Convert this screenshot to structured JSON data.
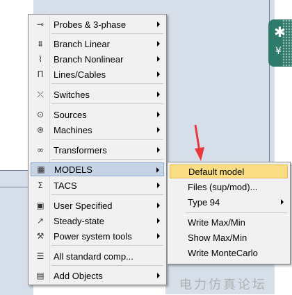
{
  "main_menu": {
    "items": [
      {
        "label": "Probes & 3-phase",
        "icon": "probe-icon",
        "glyph": "⊸"
      },
      {
        "label": "Branch Linear",
        "icon": "branch-linear-icon",
        "glyph": "⩩"
      },
      {
        "label": "Branch Nonlinear",
        "icon": "branch-nonlinear-icon",
        "glyph": "⌇"
      },
      {
        "label": "Lines/Cables",
        "icon": "lines-cables-icon",
        "glyph": "Π"
      },
      {
        "label": "Switches",
        "icon": "switch-icon",
        "glyph": "⤫"
      },
      {
        "label": "Sources",
        "icon": "source-icon",
        "glyph": "⊙"
      },
      {
        "label": "Machines",
        "icon": "machine-icon",
        "glyph": "⊛"
      },
      {
        "label": "Transformers",
        "icon": "transformer-icon",
        "glyph": "∞"
      },
      {
        "label": "MODELS",
        "icon": "models-icon",
        "glyph": "▦"
      },
      {
        "label": "TACS",
        "icon": "tacs-icon",
        "glyph": "Σ"
      },
      {
        "label": "User Specified",
        "icon": "user-specified-icon",
        "glyph": "▣"
      },
      {
        "label": "Steady-state",
        "icon": "steady-state-icon",
        "glyph": "↗"
      },
      {
        "label": "Power system tools",
        "icon": "power-tools-icon",
        "glyph": "⚒"
      },
      {
        "label": "All standard comp...",
        "icon": "all-components-icon",
        "glyph": "☰"
      },
      {
        "label": "Add Objects",
        "icon": "add-objects-icon",
        "glyph": "▤"
      }
    ]
  },
  "sub_menu": {
    "items": [
      {
        "label": "Default model"
      },
      {
        "label": "Files (sup/mod)..."
      },
      {
        "label": "Type 94"
      },
      {
        "label": "Write Max/Min"
      },
      {
        "label": "Show Max/Min"
      },
      {
        "label": "Write MonteCarlo"
      }
    ]
  },
  "watermark": "电力仿真论坛",
  "app_icon": {
    "glyph_top": "✱",
    "glyph_bottom": "¥"
  },
  "colors": {
    "hover_main": "#c5d3e5",
    "hover_sub": "#f8dd85",
    "arrow": "#e8383d"
  }
}
